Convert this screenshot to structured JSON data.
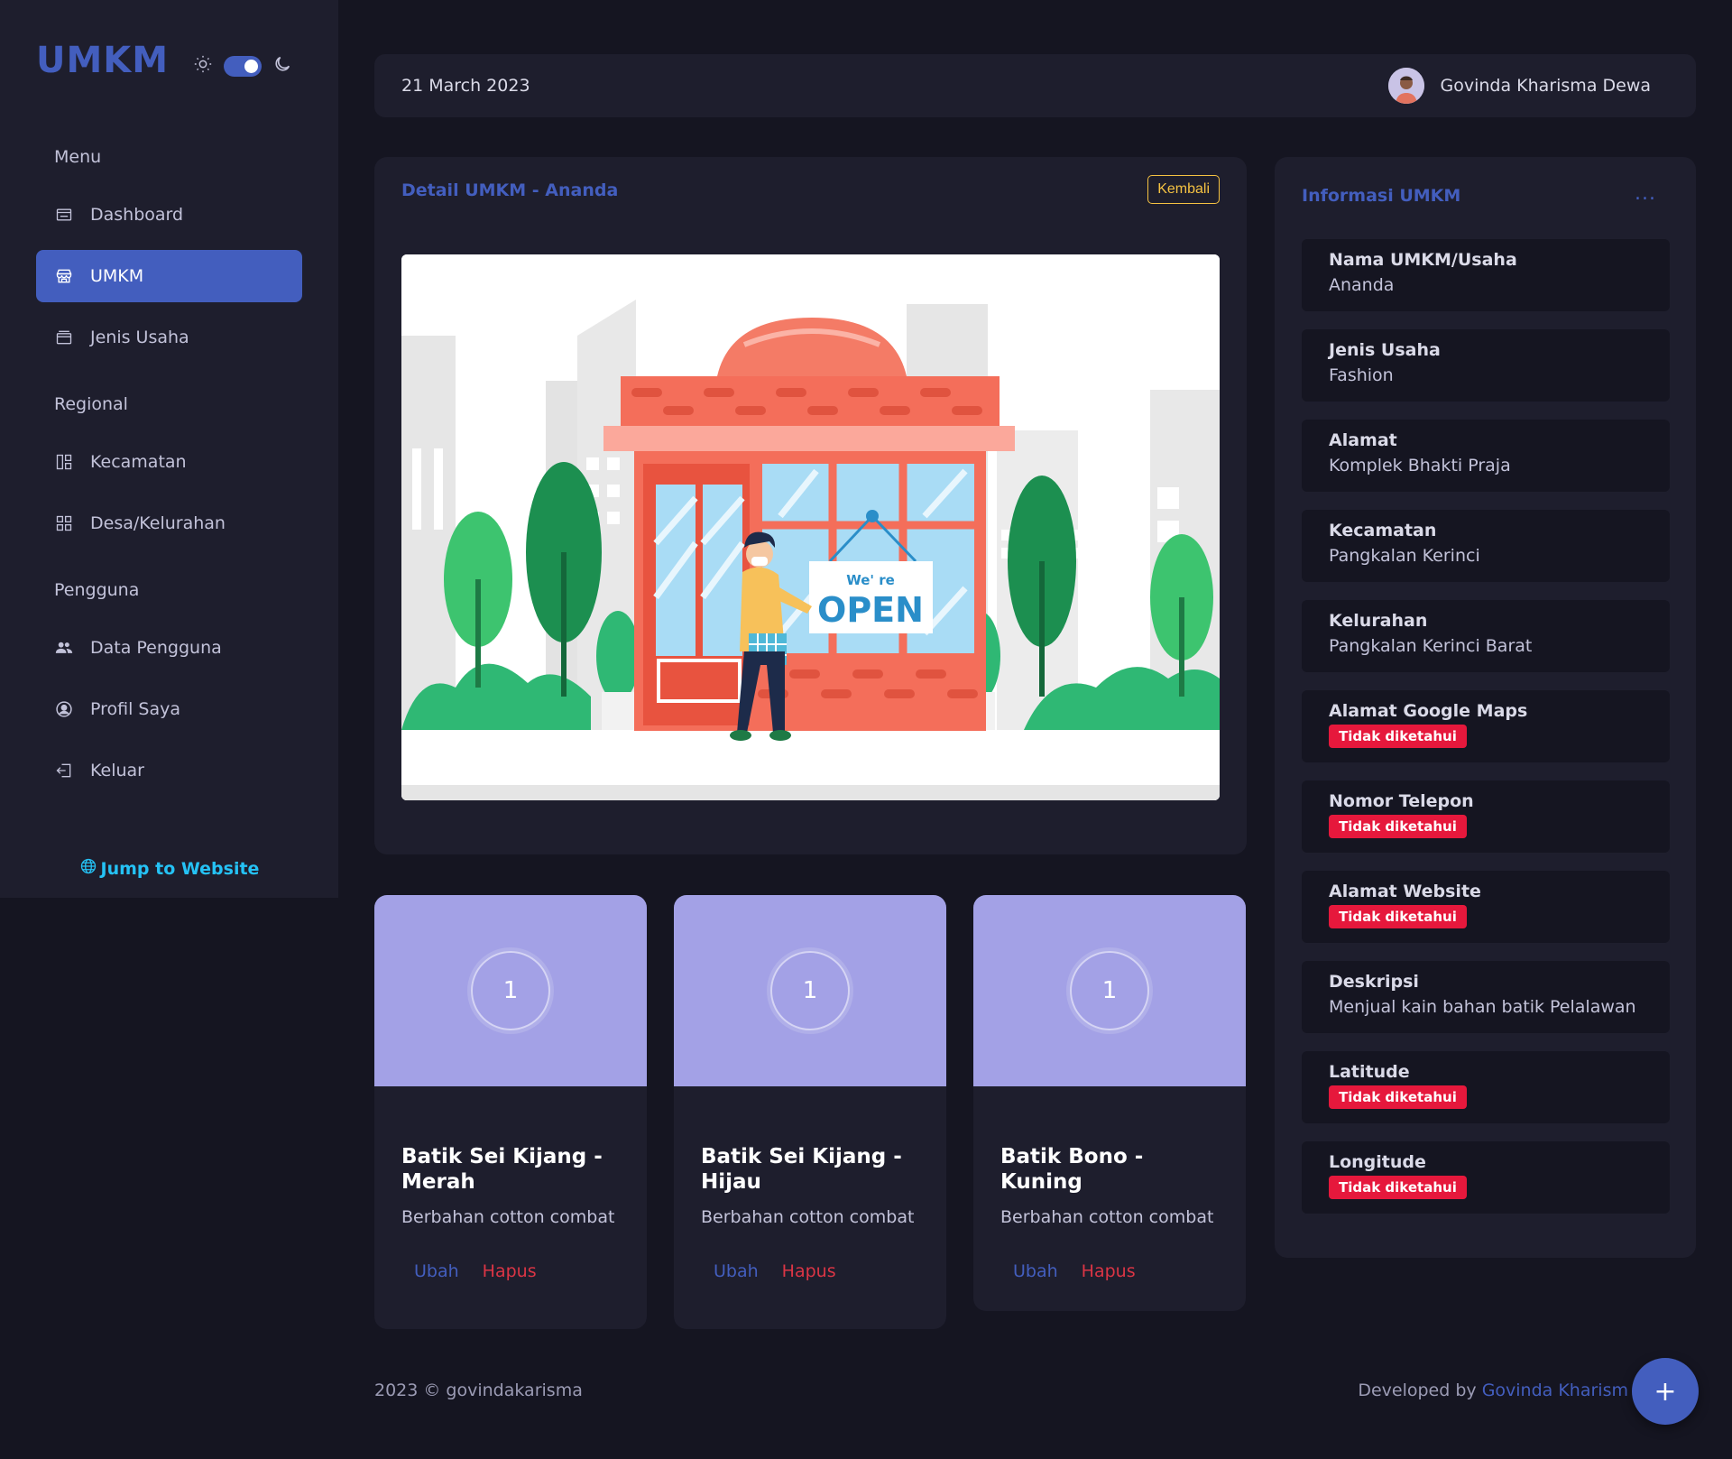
{
  "sidebar": {
    "logo": "UMKM",
    "sections": {
      "menu": "Menu",
      "regional": "Regional",
      "pengguna": "Pengguna"
    },
    "items": [
      {
        "label": "Dashboard",
        "icon": "dashboard-icon"
      },
      {
        "label": "UMKM",
        "icon": "store-icon",
        "active": true
      },
      {
        "label": "Jenis Usaha",
        "icon": "briefcase-icon"
      },
      {
        "label": "Kecamatan",
        "icon": "grid-icon"
      },
      {
        "label": "Desa/Kelurahan",
        "icon": "grid-alt-icon"
      },
      {
        "label": "Data Pengguna",
        "icon": "users-icon"
      },
      {
        "label": "Profil Saya",
        "icon": "user-circle-icon"
      },
      {
        "label": "Keluar",
        "icon": "logout-icon"
      }
    ],
    "jump_link": "Jump to Website"
  },
  "header": {
    "date": "21 March 2023",
    "user_name": "Govinda Kharisma Dewa"
  },
  "detail": {
    "title": "Detail UMKM - Ananda",
    "back_button": "Kembali",
    "illustration": {
      "sign_small": "We' re",
      "sign_big": "OPEN"
    }
  },
  "products": [
    {
      "title": "Batik Sei Kijang - Merah",
      "desc": "Berbahan cotton combat",
      "edit": "Ubah",
      "delete": "Hapus",
      "image_label": "1"
    },
    {
      "title": "Batik Sei Kijang - Hijau",
      "desc": "Berbahan cotton combat",
      "edit": "Ubah",
      "delete": "Hapus",
      "image_label": "1"
    },
    {
      "title": "Batik Bono - Kuning",
      "desc": "Berbahan cotton combat",
      "edit": "Ubah",
      "delete": "Hapus",
      "image_label": "1"
    }
  ],
  "info": {
    "title": "Informasi UMKM",
    "menu_dots": "...",
    "unknown": "Tidak diketahui",
    "fields": [
      {
        "label": "Nama UMKM/Usaha",
        "value": "Ananda"
      },
      {
        "label": "Jenis Usaha",
        "value": "Fashion"
      },
      {
        "label": "Alamat",
        "value": "Komplek Bhakti Praja"
      },
      {
        "label": "Kecamatan",
        "value": "Pangkalan Kerinci"
      },
      {
        "label": "Kelurahan",
        "value": "Pangkalan Kerinci Barat"
      },
      {
        "label": "Alamat Google Maps",
        "value": "Tidak diketahui"
      },
      {
        "label": "Nomor Telepon",
        "value": "Tidak diketahui"
      },
      {
        "label": "Alamat Website",
        "value": "Tidak diketahui"
      },
      {
        "label": "Deskripsi",
        "value": "Menjual kain bahan batik Pelalawan"
      },
      {
        "label": "Latitude",
        "value": "Tidak diketahui"
      },
      {
        "label": "Longitude",
        "value": "Tidak diketahui"
      }
    ]
  },
  "footer": {
    "copyright": "2023 © govindakarisma",
    "developed_by": "Developed by",
    "developer": "Govinda Kharism"
  },
  "fab": {
    "label": "+"
  },
  "colors": {
    "accent": "#435ebe",
    "background": "#151521",
    "card": "#1e1e2d",
    "danger": "#e6183c",
    "warning": "#f5c242",
    "link_cyan": "#25c2f5"
  }
}
